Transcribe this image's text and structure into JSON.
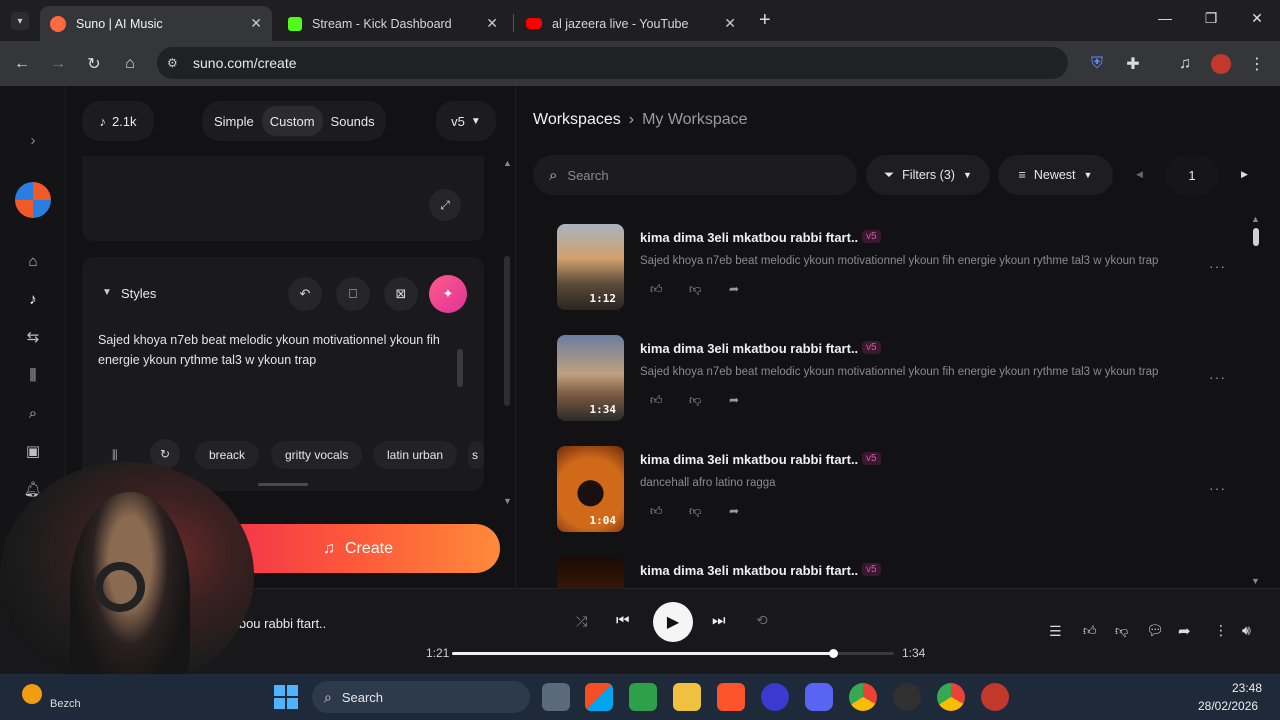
{
  "browser": {
    "tabs": [
      {
        "title": "Suno | AI Music",
        "favicon_color": "#ff6a3d",
        "active": true
      },
      {
        "title": "Stream - Kick Dashboard",
        "favicon_color": "#53fc18",
        "active": false
      },
      {
        "title": "al jazeera live - YouTube",
        "favicon_color": "#ff0000",
        "active": false
      }
    ],
    "url": "suno.com/create"
  },
  "create_panel": {
    "credits": "2.1k",
    "modes": [
      "Simple",
      "Custom",
      "Sounds"
    ],
    "active_mode": "Custom",
    "model": "v5",
    "styles_label": "Styles",
    "styles_text": "Sajed khoya n7eb beat melodic  ykoun motivationnel ykoun fih energie ykoun rythme tal3 w ykoun trap",
    "style_tags": [
      "breack",
      "gritty vocals",
      "latin urban",
      "s"
    ],
    "create_label": "Create"
  },
  "workspace": {
    "breadcrumb_root": "Workspaces",
    "breadcrumb_current": "My Workspace",
    "search_placeholder": "Search",
    "filters_label": "Filters (3)",
    "sort_label": "Newest",
    "page": "1",
    "songs": [
      {
        "title": "kima dima 3eli mkatbou rabbi ftart..",
        "version": "v5",
        "desc": "Sajed khoya n7eb beat melodic ykoun motivationnel ykoun fih energie ykoun rythme tal3 w ykoun trap",
        "duration": "1:12"
      },
      {
        "title": "kima dima 3eli mkatbou rabbi ftart..",
        "version": "v5",
        "desc": "Sajed khoya n7eb beat melodic ykoun motivationnel ykoun fih energie ykoun rythme tal3 w ykoun trap",
        "duration": "1:34"
      },
      {
        "title": "kima dima 3eli mkatbou rabbi ftart..",
        "version": "v5",
        "desc": "dancehall afro latino ragga",
        "duration": "1:04"
      },
      {
        "title": "kima dima 3eli mkatbou rabbi ftart..",
        "version": "v5",
        "desc": "",
        "duration": ""
      }
    ]
  },
  "player": {
    "track_title": "...bou rabbi ftart..",
    "elapsed": "1:21",
    "total": "1:34",
    "progress_fraction": 0.862
  },
  "taskbar": {
    "search_label": "Search",
    "time": "23:48",
    "date": "28/02/2026",
    "weather_label": "Bezch"
  }
}
